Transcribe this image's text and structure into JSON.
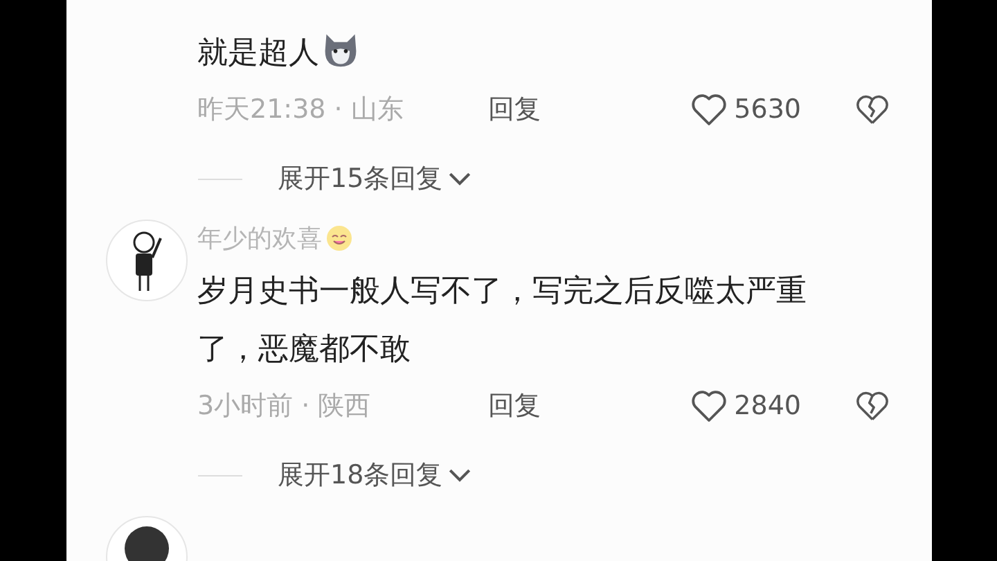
{
  "comments": [
    {
      "text": "就是超人",
      "meta": "昨天21:38 · 山东",
      "reply": "回复",
      "likes": "5630",
      "expand": "展开15条回复"
    },
    {
      "username": "年少的欢喜",
      "text": "岁月史书一般人写不了，写完之后反噬太严重了，恶魔都不敢",
      "meta": "3小时前 · 陕西",
      "reply": "回复",
      "likes": "2840",
      "expand": "展开18条回复"
    }
  ]
}
